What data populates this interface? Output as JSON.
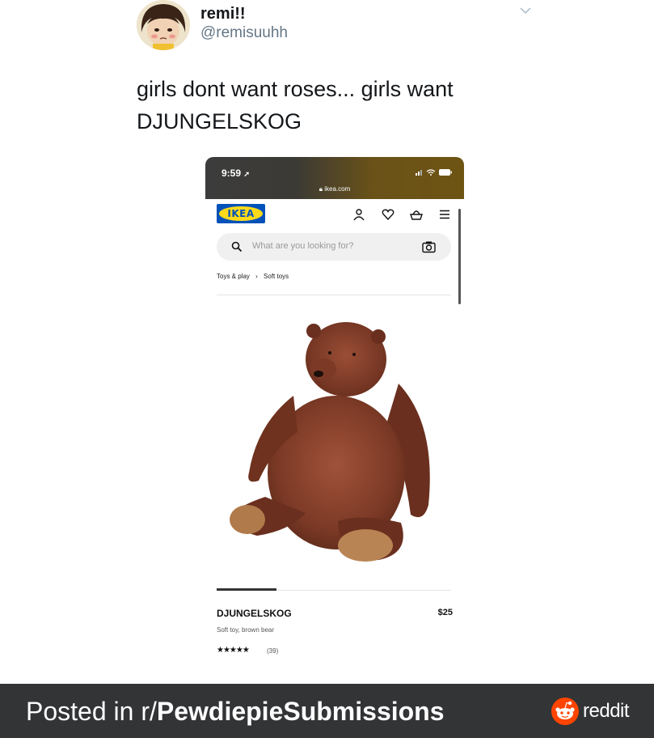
{
  "tweet": {
    "display_name": "remi!!",
    "handle": "@remisuuhh",
    "text_line1": "girls dont want roses... girls want",
    "text_line2": "DJUNGELSKOG"
  },
  "phone": {
    "time": "9:59",
    "url": "ikea.com",
    "logo_text": "IKEA",
    "search_placeholder": "What are you looking for?",
    "breadcrumb": [
      "Toys & play",
      "Soft toys"
    ],
    "breadcrumb_separator": "›",
    "product": {
      "name": "DJUNGELSKOG",
      "price": "$25",
      "description": "Soft toy, brown bear",
      "stars": "★★★★★",
      "reviews": "(39)"
    },
    "icons": [
      "profile-icon",
      "heart-icon",
      "basket-icon",
      "menu-icon",
      "search-icon",
      "camera-icon"
    ]
  },
  "footer": {
    "prefix": "Posted in r/",
    "subreddit": "PewdiepieSubmissions",
    "brand": "reddit"
  },
  "colors": {
    "footer_bg": "#333436",
    "reddit_orange": "#ff4500",
    "ikea_blue": "#0051ba",
    "ikea_yellow": "#ffda1a",
    "handle_gray": "#657786"
  }
}
